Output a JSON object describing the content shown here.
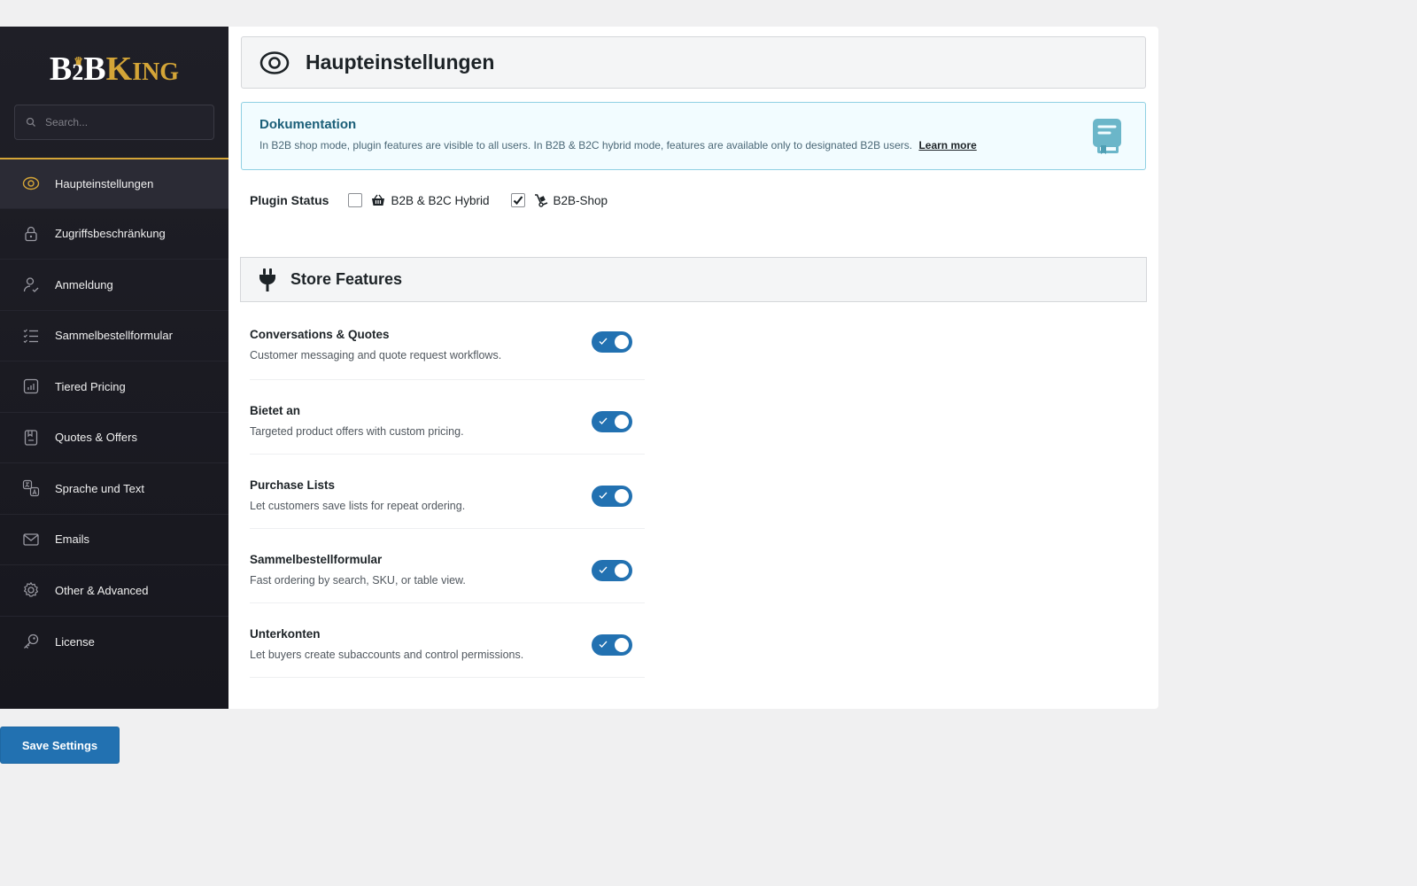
{
  "brand": {
    "logo_b": "B",
    "logo_two": "2",
    "logo_b2": "B",
    "logo_k": "K",
    "logo_ing": "ING",
    "accent_color": "#d4a537"
  },
  "search": {
    "placeholder": "Search..."
  },
  "sidebar": {
    "items": [
      {
        "label": "Haupteinstellungen",
        "icon": "eye-ring-icon",
        "active": true
      },
      {
        "label": "Zugriffsbeschränkung",
        "icon": "lock-icon",
        "active": false
      },
      {
        "label": "Anmeldung",
        "icon": "user-check-icon",
        "active": false
      },
      {
        "label": "Sammelbestellformular",
        "icon": "list-check-icon",
        "active": false
      },
      {
        "label": "Tiered Pricing",
        "icon": "chart-icon",
        "active": false
      },
      {
        "label": "Quotes & Offers",
        "icon": "document-icon",
        "active": false
      },
      {
        "label": "Sprache und Text",
        "icon": "translate-icon",
        "active": false
      },
      {
        "label": "Emails",
        "icon": "envelope-icon",
        "active": false
      },
      {
        "label": "Other & Advanced",
        "icon": "gear-icon",
        "active": false
      },
      {
        "label": "License",
        "icon": "key-icon",
        "active": false
      }
    ]
  },
  "header": {
    "title": "Haupteinstellungen",
    "icon": "eye-ring-icon"
  },
  "documentation": {
    "title": "Dokumentation",
    "text": "In B2B shop mode, plugin features are visible to all users. In B2B & B2C hybrid mode, features are available only to designated B2B users.",
    "link": "Learn more",
    "icon": "book-icon"
  },
  "plugin_status": {
    "label": "Plugin Status",
    "options": [
      {
        "label": "B2B & B2C Hybrid",
        "checked": false,
        "icon": "basket-icon"
      },
      {
        "label": "B2B-Shop",
        "checked": true,
        "icon": "dolly-icon"
      }
    ]
  },
  "store_features": {
    "title": "Store Features",
    "icon": "plug-icon",
    "items": [
      {
        "name": "Conversations & Quotes",
        "desc": "Customer messaging and quote request workflows.",
        "enabled": true
      },
      {
        "name": "Bietet an",
        "desc": "Targeted product offers with custom pricing.",
        "enabled": true
      },
      {
        "name": "Purchase Lists",
        "desc": "Let customers save lists for repeat ordering.",
        "enabled": true
      },
      {
        "name": "Sammelbestellformular",
        "desc": "Fast ordering by search, SKU, or table view.",
        "enabled": true
      },
      {
        "name": "Unterkonten",
        "desc": "Let buyers create subaccounts and control permissions.",
        "enabled": true
      }
    ]
  },
  "save_button": "Save Settings"
}
